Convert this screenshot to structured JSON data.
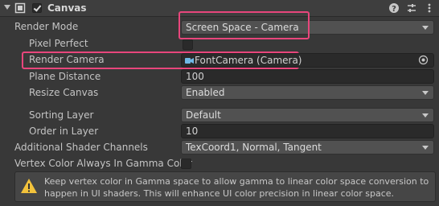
{
  "component": {
    "title": "Canvas",
    "enabled": true
  },
  "header_icons": [
    "help-icon",
    "preset-icon",
    "more-icon"
  ],
  "fields": {
    "render_mode": {
      "label": "Render Mode",
      "value": "Screen Space - Camera"
    },
    "pixel_perfect": {
      "label": "Pixel Perfect",
      "checked": false
    },
    "render_camera": {
      "label": "Render Camera",
      "value": "FontCamera (Camera)"
    },
    "plane_distance": {
      "label": "Plane Distance",
      "value": "100"
    },
    "resize_canvas": {
      "label": "Resize Canvas",
      "value": "Enabled"
    },
    "sorting_layer": {
      "label": "Sorting Layer",
      "value": "Default"
    },
    "order_in_layer": {
      "label": "Order in Layer",
      "value": "10"
    },
    "shader_channels": {
      "label": "Additional Shader Channels",
      "value": "TexCoord1, Normal, Tangent"
    },
    "vertex_color_gamma": {
      "label": "Vertex Color Always In Gamma Color",
      "checked": false
    }
  },
  "info_box": {
    "text": "Keep vertex color in Gamma space to allow gamma to linear color space conversion to happen in UI shaders. This will enhance UI color precision in linear color space."
  },
  "colors": {
    "highlight": "#e8467c",
    "background": "#383838"
  }
}
